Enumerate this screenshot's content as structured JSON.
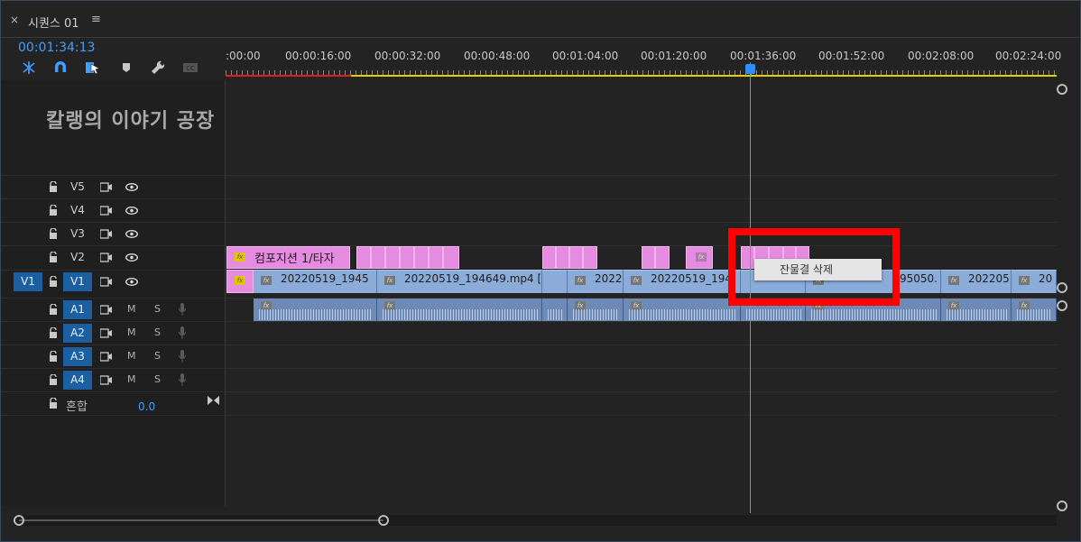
{
  "panel": {
    "close_glyph": "×",
    "title": "시퀀스 01",
    "menu_glyph": "≡",
    "timecode": "00:01:34:13"
  },
  "tools": [
    "ripple-insert-icon",
    "snap-magnet-icon",
    "linked-selection-icon",
    "marker-icon",
    "wrench-settings-icon",
    "captions-icon"
  ],
  "tools_labels": {
    "captions": "CC"
  },
  "ruler": {
    "labels": [
      ":00:00",
      "00:00:16:00",
      "00:00:32:00",
      "00:00:48:00",
      "00:01:04:00",
      "00:01:20:00",
      "00:01:36:00",
      "00:01:52:00",
      "00:02:08:00",
      "00:02:24:00"
    ]
  },
  "watermark": "칼랭의 이야기 공장",
  "video_tracks": [
    {
      "name": "V5",
      "source": ""
    },
    {
      "name": "V4",
      "source": ""
    },
    {
      "name": "V3",
      "source": ""
    },
    {
      "name": "V2",
      "source": ""
    },
    {
      "name": "V1",
      "source": "V1"
    }
  ],
  "audio_tracks": [
    {
      "name": "A1",
      "m": "M",
      "s": "S"
    },
    {
      "name": "A2",
      "m": "M",
      "s": "S"
    },
    {
      "name": "A3",
      "m": "M",
      "s": "S"
    },
    {
      "name": "A4",
      "m": "M",
      "s": "S"
    }
  ],
  "mix": {
    "label": "혼합",
    "value": "0.0"
  },
  "clips": {
    "v2_first": "컴포지션 1/타자",
    "fx": "fx",
    "v1": [
      "20220519_1945",
      "20220519_194649.mp4 [",
      "2022",
      "20220519_194",
      "",
      "95050.",
      "202205",
      "20"
    ]
  },
  "context_menu": {
    "item": "잔물결 삭제"
  },
  "colors": {
    "accent": "#3f9fff",
    "highlight": "#ff0000",
    "video_clip": "#8bacd8",
    "graphic_clip": "#e58be0",
    "audio_clip": "#6e8bb8"
  }
}
